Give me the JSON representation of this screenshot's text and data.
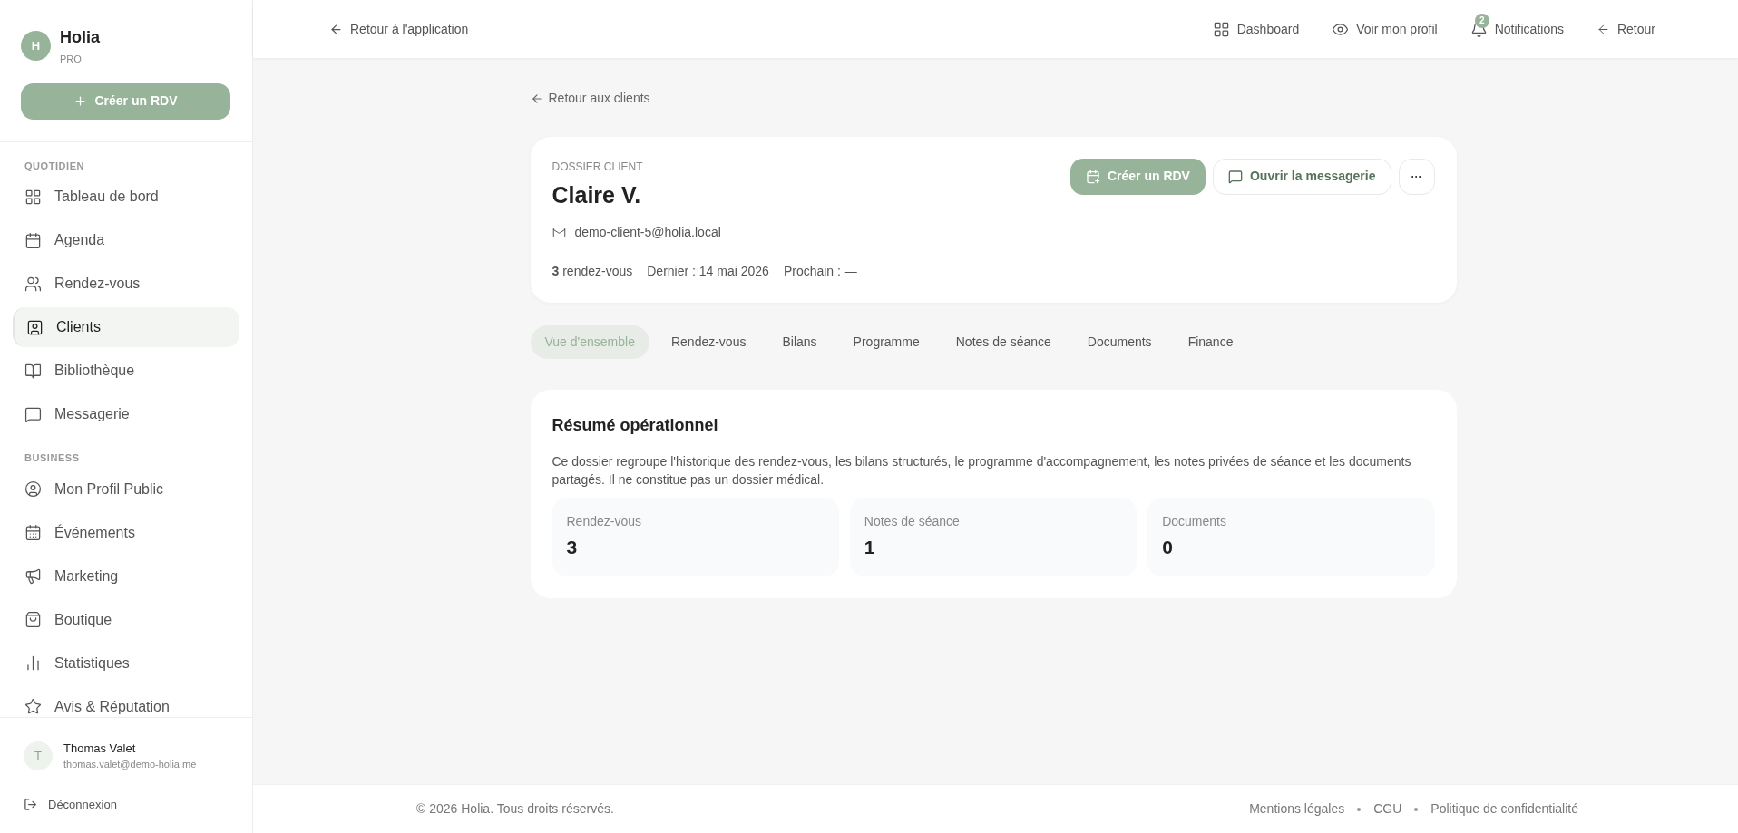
{
  "brand": {
    "initial": "H",
    "name": "Holia",
    "tier": "PRO"
  },
  "sidebar": {
    "create_button": "Créer un RDV",
    "sections": [
      {
        "title": "QUOTIDIEN",
        "items": [
          {
            "label": "Tableau de bord",
            "selected": false
          },
          {
            "label": "Agenda",
            "selected": false
          },
          {
            "label": "Rendez-vous",
            "selected": false
          },
          {
            "label": "Clients",
            "selected": true
          },
          {
            "label": "Bibliothèque",
            "selected": false
          },
          {
            "label": "Messagerie",
            "selected": false
          }
        ]
      },
      {
        "title": "BUSINESS",
        "items": [
          {
            "label": "Mon Profil Public",
            "selected": false
          },
          {
            "label": "Événements",
            "selected": false
          },
          {
            "label": "Marketing",
            "selected": false
          },
          {
            "label": "Boutique",
            "selected": false
          },
          {
            "label": "Statistiques",
            "selected": false
          },
          {
            "label": "Avis & Réputation",
            "selected": false
          }
        ]
      }
    ],
    "user": {
      "initial": "T",
      "name": "Thomas Valet",
      "email": "thomas.valet@demo-holia.me"
    },
    "logout": "Déconnexion"
  },
  "topbar": {
    "back_link": "Retour à l'application",
    "links": [
      {
        "label": "Dashboard"
      },
      {
        "label": "Voir mon profil"
      },
      {
        "label": "Notifications",
        "badge": "2"
      },
      {
        "label": "Retour"
      }
    ]
  },
  "back_to_clients": "Retour aux clients",
  "client": {
    "eyebrow": "DOSSIER CLIENT",
    "name": "Claire V.",
    "email": "demo-client-5@holia.local",
    "stats": [
      "**3** rendez-vous",
      "Dernier : 14 mai 2026",
      "Prochain : —"
    ],
    "actions": {
      "primary": "Créer un RDV",
      "secondary": "Ouvrir la messagerie",
      "more": "···"
    }
  },
  "tabs": [
    {
      "label": "Vue d'ensemble",
      "selected": true
    },
    {
      "label": "Rendez-vous",
      "selected": false
    },
    {
      "label": "Bilans",
      "selected": false
    },
    {
      "label": "Programme",
      "selected": false
    },
    {
      "label": "Notes de séance",
      "selected": false
    },
    {
      "label": "Documents",
      "selected": false
    },
    {
      "label": "Finance",
      "selected": false
    }
  ],
  "summary": {
    "title": "Résumé opérationnel",
    "description": "Ce dossier regroupe l'historique des rendez-vous, les bilans structurés, le programme d'accompagnement, les notes privées de séance et les documents partagés. Il ne constitue pas un dossier médical.",
    "metrics": [
      {
        "label": "Rendez-vous",
        "value": "3"
      },
      {
        "label": "Notes de séance",
        "value": "1"
      },
      {
        "label": "Documents",
        "value": "0"
      }
    ]
  },
  "footer": {
    "copyright": "© 2026 Holia. Tous droits réservés.",
    "links": [
      "Mentions légales",
      "CGU",
      "Politique de confidentialité"
    ]
  }
}
